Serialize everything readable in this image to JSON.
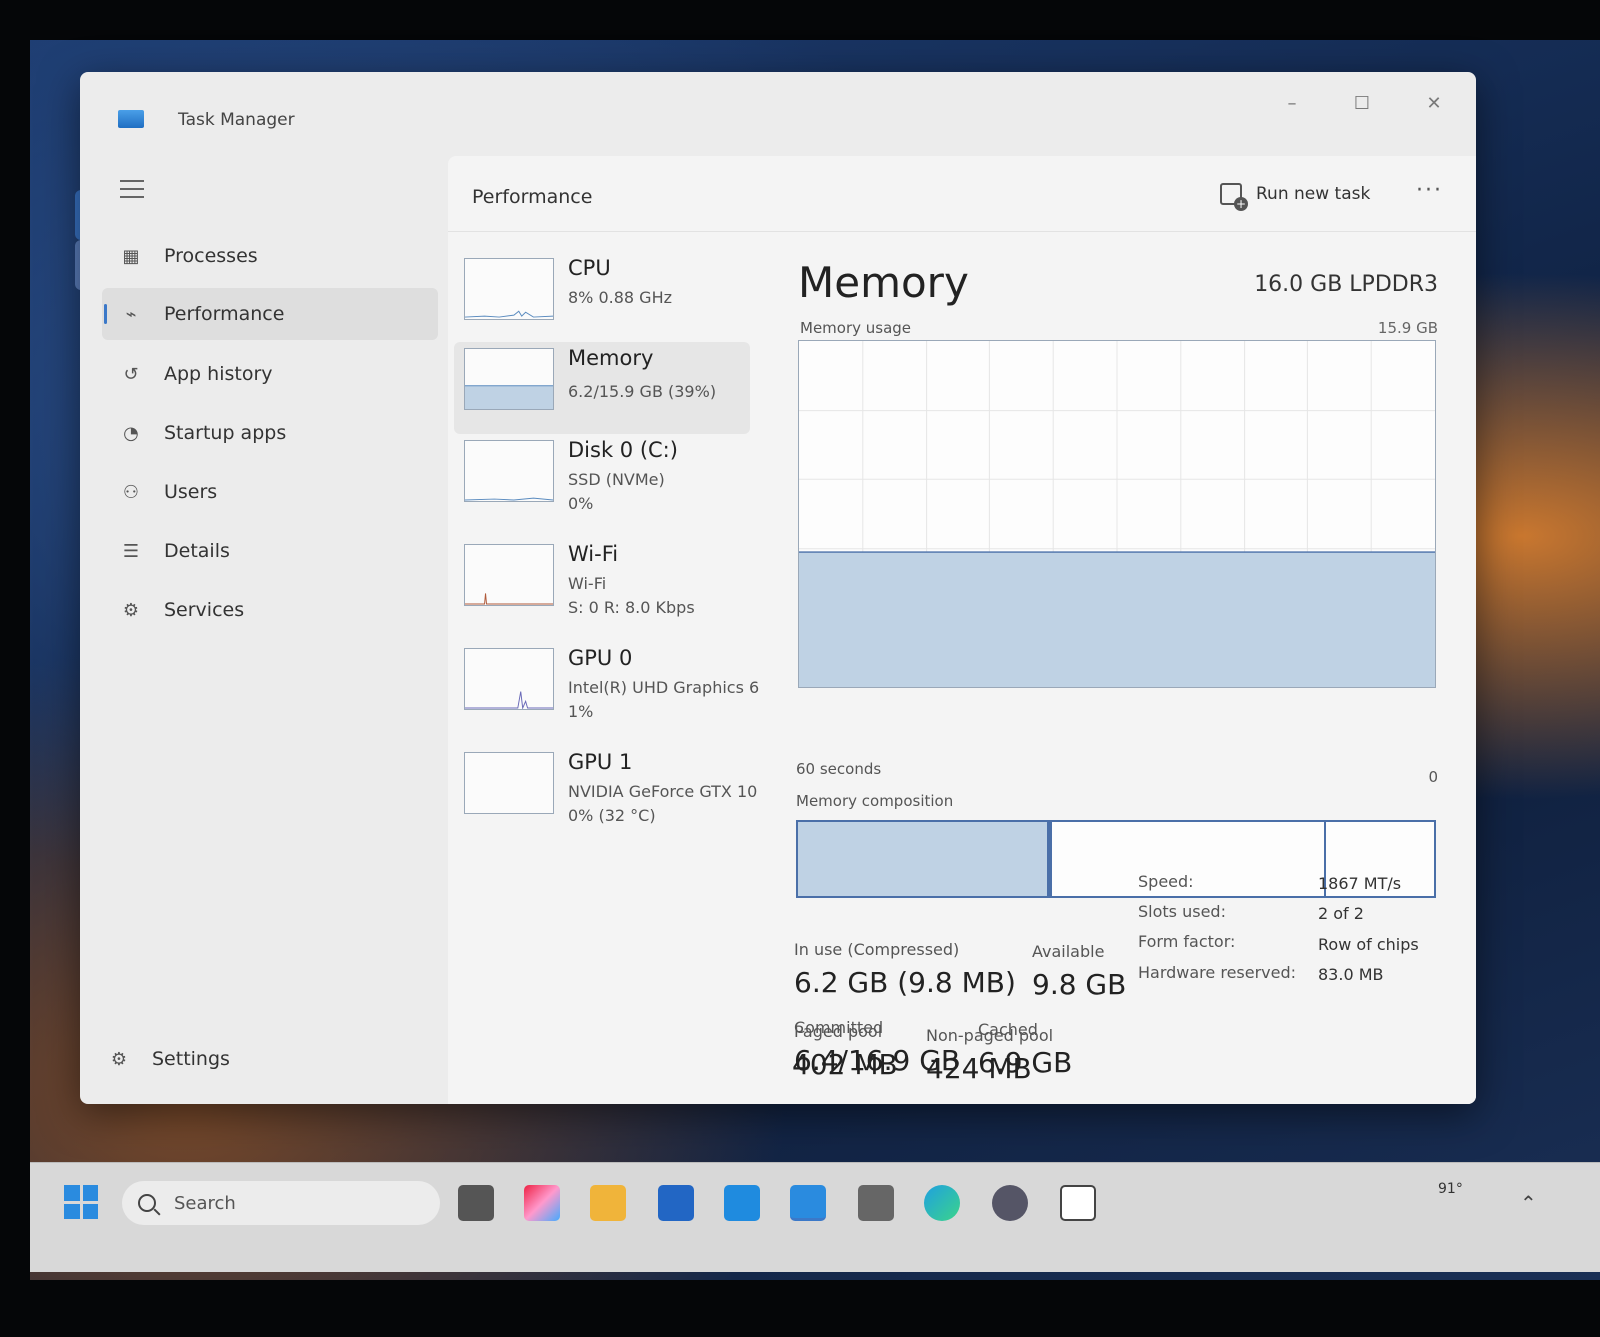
{
  "window": {
    "title": "Task Manager",
    "minimize_glyph": "–",
    "maximize_glyph": "☐",
    "close_glyph": "✕"
  },
  "sidebar": {
    "items": [
      {
        "label": "Processes",
        "icon": "processes-icon"
      },
      {
        "label": "Performance",
        "icon": "performance-icon",
        "active": true
      },
      {
        "label": "App history",
        "icon": "history-icon"
      },
      {
        "label": "Startup apps",
        "icon": "startup-icon"
      },
      {
        "label": "Users",
        "icon": "users-icon"
      },
      {
        "label": "Details",
        "icon": "details-icon"
      },
      {
        "label": "Services",
        "icon": "services-icon"
      }
    ],
    "settings_label": "Settings"
  },
  "header": {
    "title": "Performance",
    "run_task_label": "Run new task",
    "more_glyph": "···"
  },
  "resources": [
    {
      "name": "CPU",
      "line1": "8% 0.88 GHz",
      "line2": ""
    },
    {
      "name": "Memory",
      "line1": "6.2/15.9 GB (39%)",
      "line2": "",
      "active": true
    },
    {
      "name": "Disk 0 (C:)",
      "line1": "SSD (NVMe)",
      "line2": "0%"
    },
    {
      "name": "Wi-Fi",
      "line1": "Wi-Fi",
      "line2": "S: 0 R: 8.0 Kbps"
    },
    {
      "name": "GPU 0",
      "line1": "Intel(R) UHD Graphics 6",
      "line2": "1%"
    },
    {
      "name": "GPU 1",
      "line1": "NVIDIA GeForce GTX 10",
      "line2": "0% (32 °C)"
    }
  ],
  "detail": {
    "title": "Memory",
    "spec": "16.0 GB LPDDR3",
    "usage_label": "Memory usage",
    "usage_max": "15.9 GB",
    "usage_fraction": 0.39,
    "axis_left": "60 seconds",
    "axis_right": "0",
    "composition_label": "Memory composition",
    "composition": {
      "in_use": 0.39,
      "modified": 0.01,
      "standby": 0.43,
      "free": 0.17
    },
    "stats": {
      "in_use_label": "In use (Compressed)",
      "in_use_value": "6.2 GB (9.8 MB)",
      "available_label": "Available",
      "available_value": "9.8 GB",
      "committed_label": "Committed",
      "committed_value": "6.4/16.9 GB",
      "cached_label": "Cached",
      "cached_value": "6.9 GB",
      "paged_label": "Paged pool",
      "paged_value": "402 MB",
      "nonpaged_label": "Non-paged pool",
      "nonpaged_value": "424 MB"
    },
    "specs": [
      {
        "label": "Speed:",
        "value": "1867 MT/s"
      },
      {
        "label": "Slots used:",
        "value": "2 of 2"
      },
      {
        "label": "Form factor:",
        "value": "Row of chips"
      },
      {
        "label": "Hardware reserved:",
        "value": "83.0 MB"
      }
    ]
  },
  "taskbar": {
    "search_placeholder": "Search",
    "weather": "91°"
  },
  "colors": {
    "accent": "#3b78c8",
    "graph_fill": "#bfd2e4",
    "graph_border": "#4a6fa8"
  }
}
